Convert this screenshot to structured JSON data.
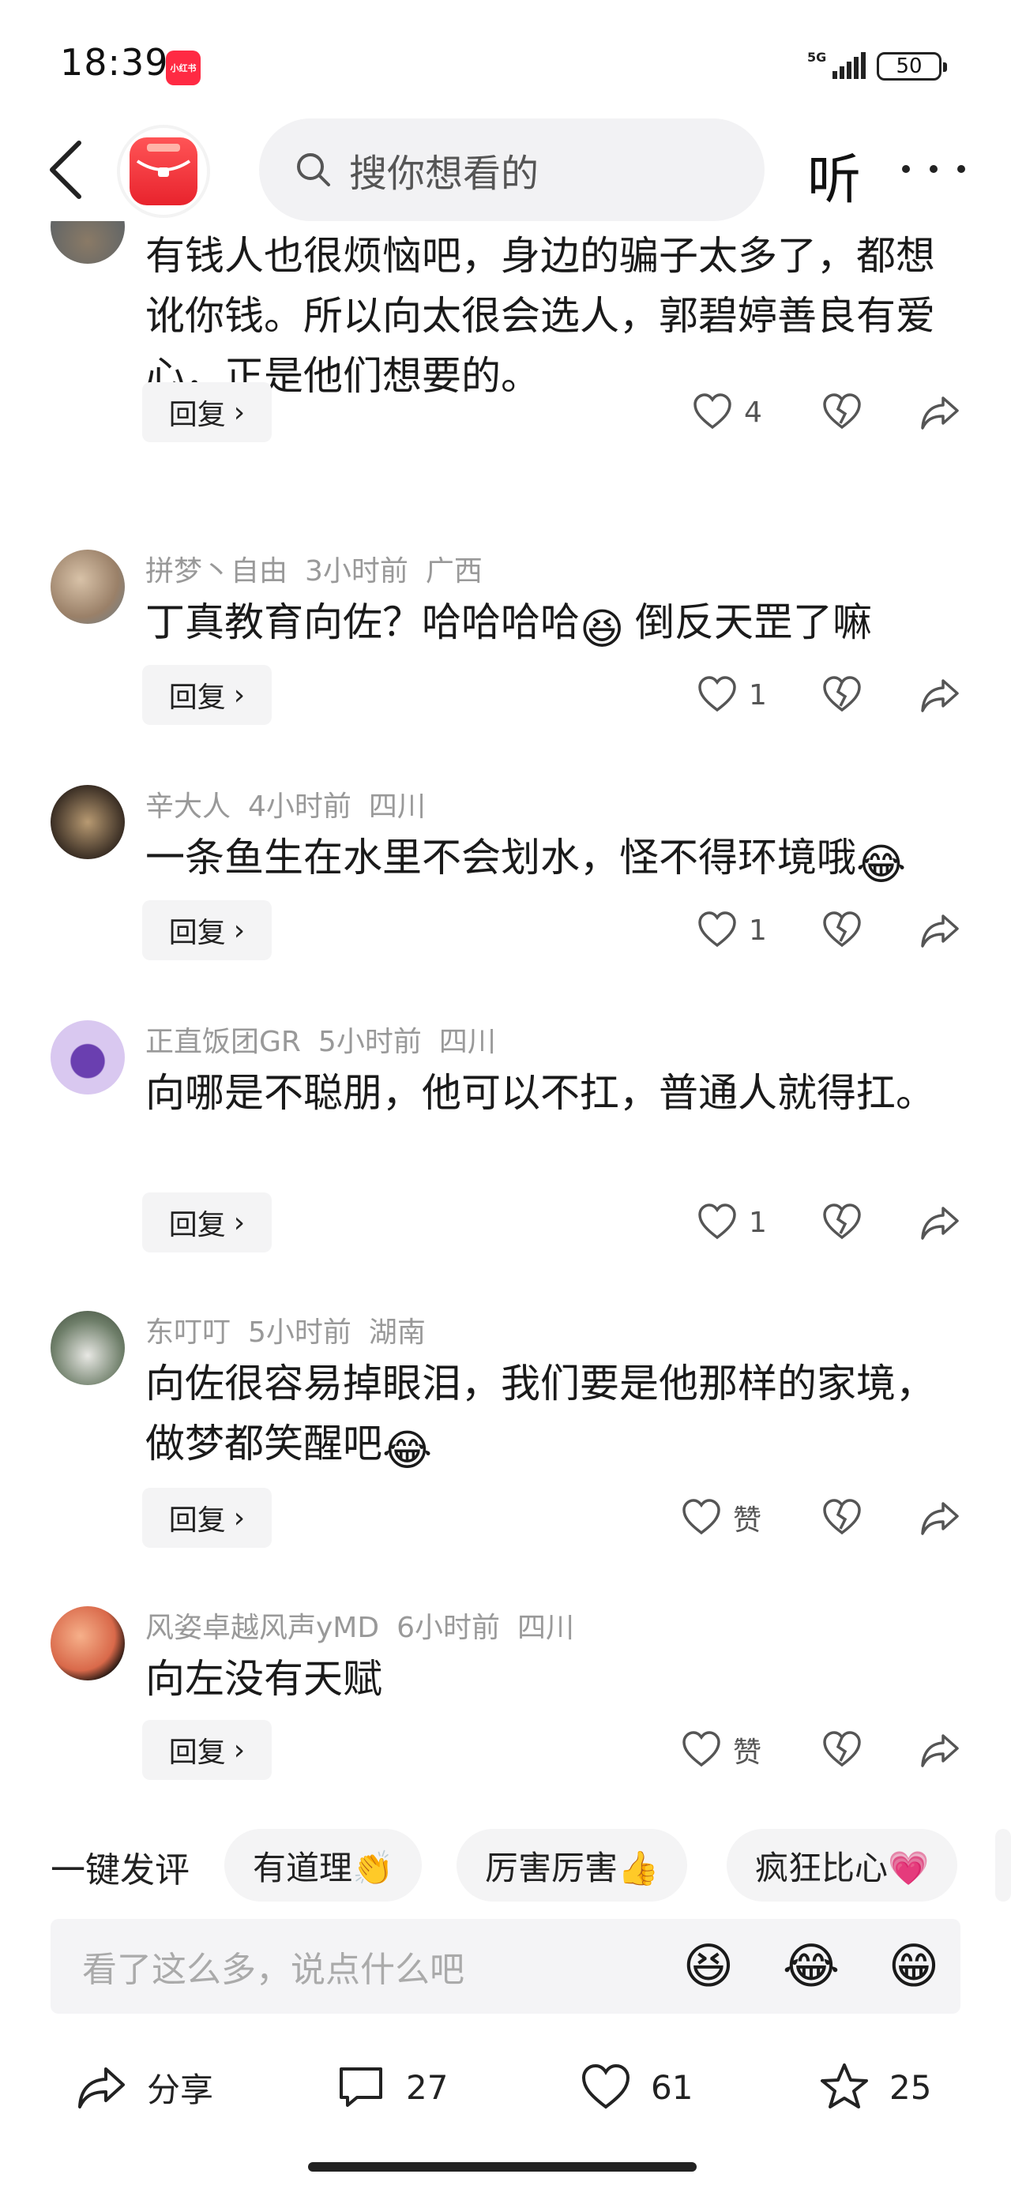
{
  "status": {
    "time": "18:39",
    "network": "5G",
    "battery": "50",
    "app_badge": "小红书"
  },
  "header": {
    "search_placeholder": "搜你想看的",
    "listen_label": "听"
  },
  "comments": [
    {
      "user": "",
      "time": "",
      "location": "",
      "text": "有钱人也很烦恼吧，身边的骗子太多了，都想讹你钱。所以向太很会选人，郭碧婷善良有爱心，正是他们想要的。",
      "likes": "4",
      "reply_label": "回复"
    },
    {
      "user": "拼梦丶自由",
      "time": "3小时前",
      "location": "广西",
      "text_before": "丁真教育向佐？哈哈哈哈",
      "emoji": "😆",
      "text_after": "倒反天罡了嘛",
      "likes": "1",
      "reply_label": "回复"
    },
    {
      "user": "辛大人",
      "time": "4小时前",
      "location": "四川",
      "text_before": "一条鱼生在水里不会划水，怪不得环境哦",
      "emoji": "😂",
      "text_after": "",
      "likes": "1",
      "reply_label": "回复"
    },
    {
      "user": "正直饭团GR",
      "time": "5小时前",
      "location": "四川",
      "text": "向哪是不聪朋，他可以不扛，普通人就得扛。",
      "likes": "1",
      "reply_label": "回复"
    },
    {
      "user": "东叮叮",
      "time": "5小时前",
      "location": "湖南",
      "text_before": "向佐很容易掉眼泪，我们要是他那样的家境，做梦都笑醒吧",
      "emoji": "😂",
      "text_after": "",
      "likes": "赞",
      "reply_label": "回复"
    },
    {
      "user": "风姿卓越风声yMD",
      "time": "6小时前",
      "location": "四川",
      "text": "向左没有天赋",
      "likes": "赞",
      "reply_label": "回复"
    }
  ],
  "quick_comments": {
    "label": "一键发评",
    "chips": [
      "有道理👏",
      "厉害厉害👍",
      "疯狂比心💗"
    ]
  },
  "input": {
    "placeholder": "看了这么多，说点什么吧",
    "emojis": [
      "😆",
      "😂",
      "😁"
    ]
  },
  "bottom_bar": {
    "share_label": "分享",
    "comments_count": "27",
    "likes_count": "61",
    "favorites_count": "25"
  },
  "colors": {
    "brand_red": "#ff2a43",
    "meta_gray": "#999999",
    "chip_bg": "#f4f4f5"
  }
}
